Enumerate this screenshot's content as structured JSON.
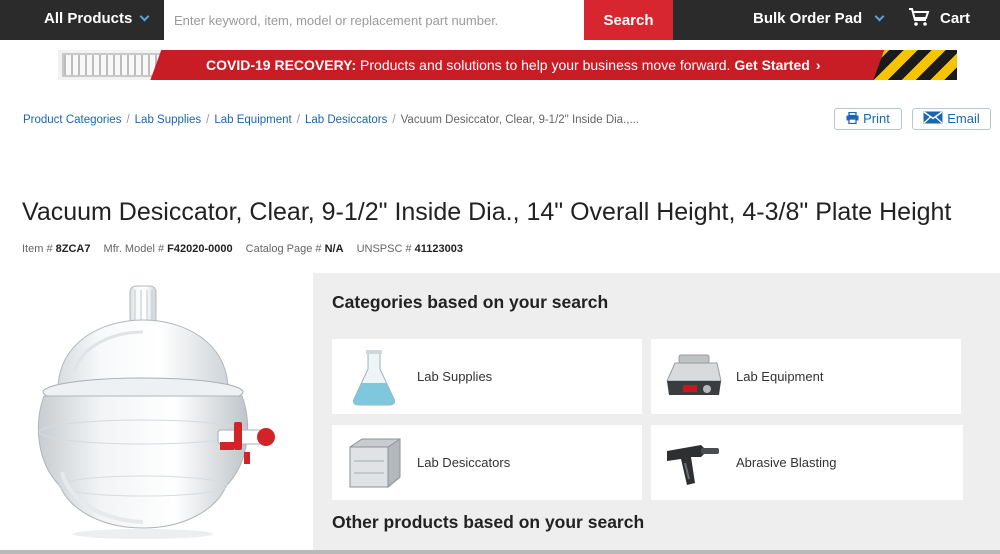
{
  "nav": {
    "all_products": "All Products",
    "search_placeholder": "Enter keyword, item, model or replacement part number.",
    "search_button": "Search",
    "bulk_order_pad": "Bulk Order Pad",
    "cart": "Cart"
  },
  "banner": {
    "headline": "COVID-19 RECOVERY:",
    "message": "Products and solutions to help your business move forward.",
    "cta": "Get Started",
    "cta_arrow": "›"
  },
  "breadcrumb": {
    "items": [
      "Product Categories",
      "Lab Supplies",
      "Lab Equipment",
      "Lab Desiccators"
    ],
    "current": "Vacuum Desiccator, Clear, 9-1/2\" Inside Dia.,...",
    "separator": "/"
  },
  "actions": {
    "print": "Print",
    "email": "Email"
  },
  "product": {
    "title": "Vacuum Desiccator, Clear, 9-1/2\" Inside Dia., 14\" Overall Height, 4-3/8\" Plate Height",
    "item_label": "Item #",
    "item": "8ZCA7",
    "mfr_label": "Mfr. Model #",
    "mfr_model": "F42020-0000",
    "catalog_label": "Catalog Page #",
    "catalog_page": "N/A",
    "unspsc_label": "UNSPSC #",
    "unspsc": "41123003"
  },
  "categories": {
    "heading": "Categories based on your search",
    "items": [
      {
        "label": "Lab Supplies",
        "icon": "flask-icon"
      },
      {
        "label": "Lab Equipment",
        "icon": "lab-instrument-icon"
      },
      {
        "label": "Lab Desiccators",
        "icon": "desiccator-cabinet-icon"
      },
      {
        "label": "Abrasive Blasting",
        "icon": "blast-gun-icon"
      }
    ],
    "other_heading": "Other products based on your search"
  },
  "colors": {
    "nav_bg": "#2b2b2b",
    "search_red": "#d7262f",
    "banner_red": "#c81d25",
    "link_blue": "#1a66b3",
    "panel_gray": "#eeeeee"
  }
}
